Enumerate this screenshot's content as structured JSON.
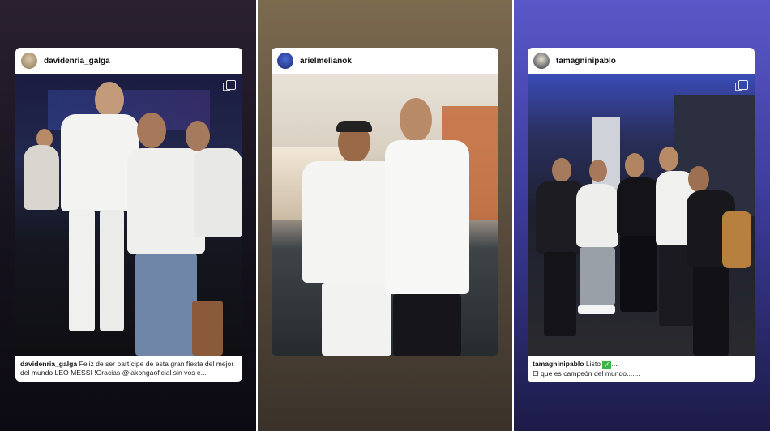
{
  "stories": [
    {
      "username": "davidenria_galga",
      "caption_user": "davidenria_galga",
      "caption_text": "Feliz de ser partícipe de esta gran fiesta del mejor del mundo LEO MESSI !Gracias @lakongaoficial sin vos e...",
      "photo_description_icon": "multi-photo-icon"
    },
    {
      "username": "arielmelianok",
      "photo_description_icon": "none"
    },
    {
      "username": "tamagninipablo",
      "caption_user": "tamagninipablo",
      "caption_text_1": "Listo",
      "caption_text_2": "....",
      "caption_line_2": "El que es campeón del mundo.......",
      "photo_description_icon": "multi-photo-icon"
    }
  ],
  "colors": {
    "panel1": "#15121d",
    "panel2": "#5e5040",
    "panel3": "#3e3c9c",
    "check": "#3bb54a"
  }
}
